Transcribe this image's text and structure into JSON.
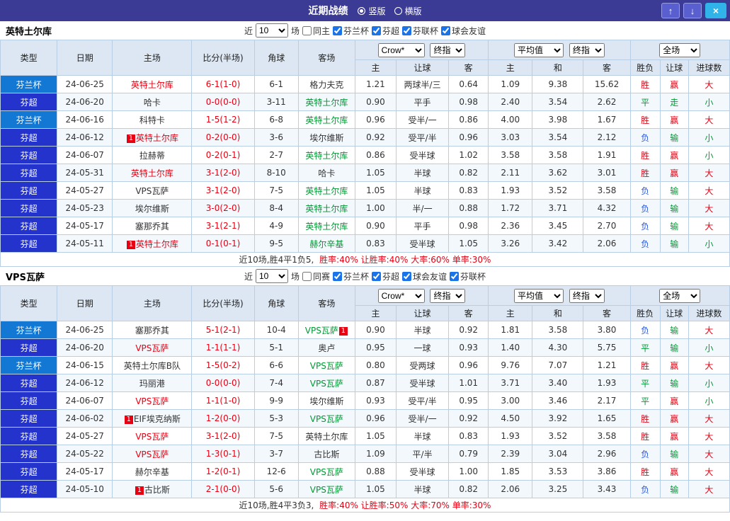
{
  "colors": {
    "topbar_bg": "#3b3a95",
    "nav_bg": "#5a5fd0",
    "nav_border": "#989ce6",
    "close_bg": "#2fb3e8",
    "header_bg": "#dce7f3",
    "border": "#b8cee4",
    "row_alt": "#f3f8fd",
    "type_cup": "#1377d4",
    "type_super": "#2433cb",
    "red": "#e60012",
    "green": "#009933",
    "blue": "#2e5bd8",
    "accent": "#1a73e8"
  },
  "topbar": {
    "title": "近期战绩",
    "vertical_label": "竖版",
    "horizontal_label": "横版",
    "up_icon": "↑",
    "down_icon": "↓",
    "close_icon": "×"
  },
  "header": {
    "type": "类型",
    "date": "日期",
    "home": "主场",
    "score": "比分(半场)",
    "corner": "角球",
    "away": "客场",
    "book_select": "Crow*",
    "final_select": "终指",
    "avg_select": "平均值",
    "full_select": "全场",
    "odds_sub": [
      "主",
      "让球",
      "客"
    ],
    "avg_sub": [
      "主",
      "和",
      "客"
    ],
    "result_sub": [
      "胜负",
      "让球",
      "进球数"
    ]
  },
  "sections": [
    {
      "team": "英特土尔库",
      "filter": {
        "near_label": "近",
        "count": "10",
        "games_label": "场",
        "same_label": "同主",
        "same_checked": false,
        "leagues": [
          {
            "label": "芬兰杯",
            "checked": true
          },
          {
            "label": "芬超",
            "checked": true
          },
          {
            "label": "芬联杯",
            "checked": true
          },
          {
            "label": "球会友谊",
            "checked": true
          }
        ]
      },
      "rows": [
        {
          "type": "芬兰杯",
          "style": "cup",
          "date": "24-06-25",
          "home": {
            "name": "英特土尔库",
            "c": "red"
          },
          "score": "6-1(1-0)",
          "corner": "6-1",
          "away": {
            "name": "格力夫克",
            "c": "black"
          },
          "odds": [
            "1.21",
            "两球半/三",
            "0.64"
          ],
          "avg": [
            "1.09",
            "9.38",
            "15.62"
          ],
          "res": [
            {
              "t": "胜",
              "c": "red"
            },
            {
              "t": "赢",
              "c": "red"
            },
            {
              "t": "大",
              "c": "red"
            }
          ]
        },
        {
          "type": "芬超",
          "style": "super",
          "date": "24-06-20",
          "home": {
            "name": "哈卡",
            "c": "black"
          },
          "score": "0-0(0-0)",
          "corner": "3-11",
          "away": {
            "name": "英特土尔库",
            "c": "green"
          },
          "odds": [
            "0.90",
            "平手",
            "0.98"
          ],
          "avg": [
            "2.40",
            "3.54",
            "2.62"
          ],
          "res": [
            {
              "t": "平",
              "c": "green"
            },
            {
              "t": "走",
              "c": "green"
            },
            {
              "t": "小",
              "c": "green"
            }
          ]
        },
        {
          "type": "芬兰杯",
          "style": "cup",
          "date": "24-06-16",
          "home": {
            "name": "科特卡",
            "c": "black"
          },
          "score": "1-5(1-2)",
          "corner": "6-8",
          "away": {
            "name": "英特土尔库",
            "c": "green"
          },
          "odds": [
            "0.96",
            "受半/一",
            "0.86"
          ],
          "avg": [
            "4.00",
            "3.98",
            "1.67"
          ],
          "res": [
            {
              "t": "胜",
              "c": "red"
            },
            {
              "t": "赢",
              "c": "red"
            },
            {
              "t": "大",
              "c": "red"
            }
          ]
        },
        {
          "type": "芬超",
          "style": "super",
          "date": "24-06-12",
          "home": {
            "name": "英特土尔库",
            "c": "red",
            "badge": "1",
            "badge_pos": "before"
          },
          "score": "0-2(0-0)",
          "corner": "3-6",
          "away": {
            "name": "埃尔维斯",
            "c": "black"
          },
          "odds": [
            "0.92",
            "受平/半",
            "0.96"
          ],
          "avg": [
            "3.03",
            "3.54",
            "2.12"
          ],
          "res": [
            {
              "t": "负",
              "c": "blue"
            },
            {
              "t": "输",
              "c": "green"
            },
            {
              "t": "小",
              "c": "green"
            }
          ]
        },
        {
          "type": "芬超",
          "style": "super",
          "date": "24-06-07",
          "home": {
            "name": "拉赫蒂",
            "c": "black"
          },
          "score": "0-2(0-1)",
          "corner": "2-7",
          "away": {
            "name": "英特土尔库",
            "c": "green"
          },
          "odds": [
            "0.86",
            "受半球",
            "1.02"
          ],
          "avg": [
            "3.58",
            "3.58",
            "1.91"
          ],
          "res": [
            {
              "t": "胜",
              "c": "red"
            },
            {
              "t": "赢",
              "c": "red"
            },
            {
              "t": "小",
              "c": "green"
            }
          ]
        },
        {
          "type": "芬超",
          "style": "super",
          "date": "24-05-31",
          "home": {
            "name": "英特土尔库",
            "c": "red"
          },
          "score": "3-1(2-0)",
          "corner": "8-10",
          "away": {
            "name": "哈卡",
            "c": "black"
          },
          "odds": [
            "1.05",
            "半球",
            "0.82"
          ],
          "avg": [
            "2.11",
            "3.62",
            "3.01"
          ],
          "res": [
            {
              "t": "胜",
              "c": "red"
            },
            {
              "t": "赢",
              "c": "red"
            },
            {
              "t": "大",
              "c": "red"
            }
          ]
        },
        {
          "type": "芬超",
          "style": "super",
          "date": "24-05-27",
          "home": {
            "name": "VPS瓦萨",
            "c": "black"
          },
          "score": "3-1(2-0)",
          "corner": "7-5",
          "away": {
            "name": "英特土尔库",
            "c": "green"
          },
          "odds": [
            "1.05",
            "半球",
            "0.83"
          ],
          "avg": [
            "1.93",
            "3.52",
            "3.58"
          ],
          "res": [
            {
              "t": "负",
              "c": "blue"
            },
            {
              "t": "输",
              "c": "green"
            },
            {
              "t": "大",
              "c": "red"
            }
          ]
        },
        {
          "type": "芬超",
          "style": "super",
          "date": "24-05-23",
          "home": {
            "name": "埃尔维斯",
            "c": "black"
          },
          "score": "3-0(2-0)",
          "corner": "8-4",
          "away": {
            "name": "英特土尔库",
            "c": "green"
          },
          "odds": [
            "1.00",
            "半/一",
            "0.88"
          ],
          "avg": [
            "1.72",
            "3.71",
            "4.32"
          ],
          "res": [
            {
              "t": "负",
              "c": "blue"
            },
            {
              "t": "输",
              "c": "green"
            },
            {
              "t": "大",
              "c": "red"
            }
          ]
        },
        {
          "type": "芬超",
          "style": "super",
          "date": "24-05-17",
          "home": {
            "name": "塞那乔其",
            "c": "black"
          },
          "score": "3-1(2-1)",
          "corner": "4-9",
          "away": {
            "name": "英特土尔库",
            "c": "green"
          },
          "odds": [
            "0.90",
            "平手",
            "0.98"
          ],
          "avg": [
            "2.36",
            "3.45",
            "2.70"
          ],
          "res": [
            {
              "t": "负",
              "c": "blue"
            },
            {
              "t": "输",
              "c": "green"
            },
            {
              "t": "大",
              "c": "red"
            }
          ]
        },
        {
          "type": "芬超",
          "style": "super",
          "date": "24-05-11",
          "home": {
            "name": "英特土尔库",
            "c": "red",
            "badge": "1",
            "badge_pos": "before"
          },
          "score": "0-1(0-1)",
          "corner": "9-5",
          "away": {
            "name": "赫尔辛基",
            "c": "green"
          },
          "odds": [
            "0.83",
            "受半球",
            "1.05"
          ],
          "avg": [
            "3.26",
            "3.42",
            "2.06"
          ],
          "res": [
            {
              "t": "负",
              "c": "blue"
            },
            {
              "t": "输",
              "c": "green"
            },
            {
              "t": "小",
              "c": "green"
            }
          ]
        }
      ],
      "summary_black": "近10场,胜4平1负5,",
      "summary_red": "胜率:40% 让胜率:40% 大率:60% 单率:30%"
    },
    {
      "team": "VPS瓦萨",
      "filter": {
        "near_label": "近",
        "count": "10",
        "games_label": "场",
        "same_label": "同赛",
        "same_checked": false,
        "leagues": [
          {
            "label": "芬兰杯",
            "checked": true
          },
          {
            "label": "芬超",
            "checked": true
          },
          {
            "label": "球会友谊",
            "checked": true
          },
          {
            "label": "芬联杯",
            "checked": true
          }
        ]
      },
      "rows": [
        {
          "type": "芬兰杯",
          "style": "cup",
          "date": "24-06-25",
          "home": {
            "name": "塞那乔其",
            "c": "black"
          },
          "score": "5-1(2-1)",
          "corner": "10-4",
          "away": {
            "name": "VPS瓦萨",
            "c": "green",
            "badge": "1",
            "badge_pos": "after"
          },
          "odds": [
            "0.90",
            "半球",
            "0.92"
          ],
          "avg": [
            "1.81",
            "3.58",
            "3.80"
          ],
          "res": [
            {
              "t": "负",
              "c": "blue"
            },
            {
              "t": "输",
              "c": "green"
            },
            {
              "t": "大",
              "c": "red"
            }
          ]
        },
        {
          "type": "芬超",
          "style": "super",
          "date": "24-06-20",
          "home": {
            "name": "VPS瓦萨",
            "c": "red"
          },
          "score": "1-1(1-1)",
          "corner": "5-1",
          "away": {
            "name": "奥卢",
            "c": "black"
          },
          "odds": [
            "0.95",
            "一球",
            "0.93"
          ],
          "avg": [
            "1.40",
            "4.30",
            "5.75"
          ],
          "res": [
            {
              "t": "平",
              "c": "green"
            },
            {
              "t": "输",
              "c": "green"
            },
            {
              "t": "小",
              "c": "green"
            }
          ]
        },
        {
          "type": "芬兰杯",
          "style": "cup",
          "date": "24-06-15",
          "home": {
            "name": "英特土尔库B队",
            "c": "black"
          },
          "score": "1-5(0-2)",
          "corner": "6-6",
          "away": {
            "name": "VPS瓦萨",
            "c": "green"
          },
          "odds": [
            "0.80",
            "受两球",
            "0.96"
          ],
          "avg": [
            "9.76",
            "7.07",
            "1.21"
          ],
          "res": [
            {
              "t": "胜",
              "c": "red"
            },
            {
              "t": "赢",
              "c": "red"
            },
            {
              "t": "大",
              "c": "red"
            }
          ]
        },
        {
          "type": "芬超",
          "style": "super",
          "date": "24-06-12",
          "home": {
            "name": "玛丽港",
            "c": "black"
          },
          "score": "0-0(0-0)",
          "corner": "7-4",
          "away": {
            "name": "VPS瓦萨",
            "c": "green"
          },
          "odds": [
            "0.87",
            "受半球",
            "1.01"
          ],
          "avg": [
            "3.71",
            "3.40",
            "1.93"
          ],
          "res": [
            {
              "t": "平",
              "c": "green"
            },
            {
              "t": "输",
              "c": "green"
            },
            {
              "t": "小",
              "c": "green"
            }
          ]
        },
        {
          "type": "芬超",
          "style": "super",
          "date": "24-06-07",
          "home": {
            "name": "VPS瓦萨",
            "c": "red"
          },
          "score": "1-1(1-0)",
          "corner": "9-9",
          "away": {
            "name": "埃尔维斯",
            "c": "black"
          },
          "odds": [
            "0.93",
            "受平/半",
            "0.95"
          ],
          "avg": [
            "3.00",
            "3.46",
            "2.17"
          ],
          "res": [
            {
              "t": "平",
              "c": "green"
            },
            {
              "t": "赢",
              "c": "red"
            },
            {
              "t": "小",
              "c": "green"
            }
          ]
        },
        {
          "type": "芬超",
          "style": "super",
          "date": "24-06-02",
          "home": {
            "name": "EIF埃克纳斯",
            "c": "black",
            "badge": "1",
            "badge_pos": "before"
          },
          "score": "1-2(0-0)",
          "corner": "5-3",
          "away": {
            "name": "VPS瓦萨",
            "c": "green"
          },
          "odds": [
            "0.96",
            "受半/一",
            "0.92"
          ],
          "avg": [
            "4.50",
            "3.92",
            "1.65"
          ],
          "res": [
            {
              "t": "胜",
              "c": "red"
            },
            {
              "t": "赢",
              "c": "red"
            },
            {
              "t": "大",
              "c": "red"
            }
          ]
        },
        {
          "type": "芬超",
          "style": "super",
          "date": "24-05-27",
          "home": {
            "name": "VPS瓦萨",
            "c": "red"
          },
          "score": "3-1(2-0)",
          "corner": "7-5",
          "away": {
            "name": "英特土尔库",
            "c": "black"
          },
          "odds": [
            "1.05",
            "半球",
            "0.83"
          ],
          "avg": [
            "1.93",
            "3.52",
            "3.58"
          ],
          "res": [
            {
              "t": "胜",
              "c": "red"
            },
            {
              "t": "赢",
              "c": "red"
            },
            {
              "t": "大",
              "c": "red"
            }
          ]
        },
        {
          "type": "芬超",
          "style": "super",
          "date": "24-05-22",
          "home": {
            "name": "VPS瓦萨",
            "c": "red"
          },
          "score": "1-3(0-1)",
          "corner": "3-7",
          "away": {
            "name": "古比斯",
            "c": "black"
          },
          "odds": [
            "1.09",
            "平/半",
            "0.79"
          ],
          "avg": [
            "2.39",
            "3.04",
            "2.96"
          ],
          "res": [
            {
              "t": "负",
              "c": "blue"
            },
            {
              "t": "输",
              "c": "green"
            },
            {
              "t": "大",
              "c": "red"
            }
          ]
        },
        {
          "type": "芬超",
          "style": "super",
          "date": "24-05-17",
          "home": {
            "name": "赫尔辛基",
            "c": "black"
          },
          "score": "1-2(0-1)",
          "corner": "12-6",
          "away": {
            "name": "VPS瓦萨",
            "c": "green"
          },
          "odds": [
            "0.88",
            "受半球",
            "1.00"
          ],
          "avg": [
            "1.85",
            "3.53",
            "3.86"
          ],
          "res": [
            {
              "t": "胜",
              "c": "red"
            },
            {
              "t": "赢",
              "c": "red"
            },
            {
              "t": "大",
              "c": "red"
            }
          ]
        },
        {
          "type": "芬超",
          "style": "super",
          "date": "24-05-10",
          "home": {
            "name": "古比斯",
            "c": "black",
            "badge": "1",
            "badge_pos": "before"
          },
          "score": "2-1(0-0)",
          "corner": "5-6",
          "away": {
            "name": "VPS瓦萨",
            "c": "green"
          },
          "odds": [
            "1.05",
            "半球",
            "0.82"
          ],
          "avg": [
            "2.06",
            "3.25",
            "3.43"
          ],
          "res": [
            {
              "t": "负",
              "c": "blue"
            },
            {
              "t": "输",
              "c": "green"
            },
            {
              "t": "大",
              "c": "red"
            }
          ]
        }
      ],
      "summary_black": "近10场,胜4平3负3,",
      "summary_red": "胜率:40% 让胜率:50% 大率:70% 单率:30%"
    }
  ]
}
